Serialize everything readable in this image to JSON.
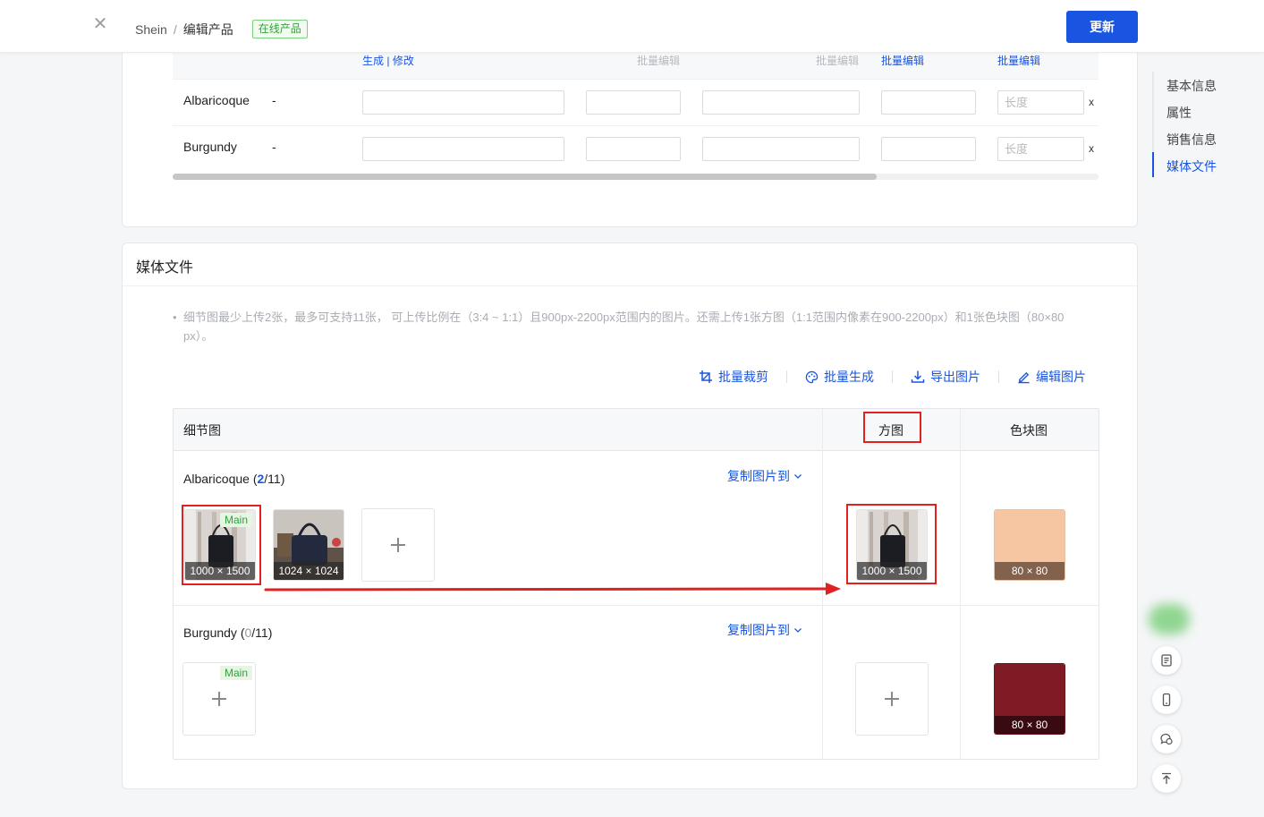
{
  "header": {
    "breadcrumb_root": "Shein",
    "breadcrumb_sep": "/",
    "breadcrumb_current": "编辑产品",
    "status_tag": "在线产品",
    "update_button": "更新"
  },
  "variants_table": {
    "header_links": {
      "generate": "生成",
      "divider": "|",
      "modify": "修改",
      "batch_edit_gray_1": "批量编辑",
      "batch_edit_gray_2": "批量编辑",
      "batch_edit_1": "批量编辑",
      "batch_edit_2": "批量编辑"
    },
    "rows": [
      {
        "name": "Albaricoque",
        "dash": "-",
        "length_placeholder": "长度",
        "x": "x"
      },
      {
        "name": "Burgundy",
        "dash": "-",
        "length_placeholder": "长度",
        "x": "x"
      }
    ]
  },
  "media": {
    "title": "媒体文件",
    "note_bullet": "•",
    "note": "细节图最少上传2张，最多可支持11张， 可上传比例在（3:4 ~ 1:1）且900px-2200px范围内的图片。还需上传1张方图（1:1范围内像素在900-2200px）和1张色块图（80×80 px）。",
    "actions": {
      "batch_crop": "批量裁剪",
      "batch_generate": "批量生成",
      "export_images": "导出图片",
      "edit_images": "编辑图片"
    },
    "columns": {
      "detail": "细节图",
      "square": "方图",
      "swatch": "色块图"
    },
    "copy_to": "复制图片到",
    "rows": [
      {
        "name": "Albaricoque",
        "count_open": "(",
        "count_current": "2",
        "count_max": "/11)",
        "main_badge": "Main",
        "detail_dims": [
          "1000 × 1500",
          "1024 × 1024"
        ],
        "square_dims": "1000 × 1500",
        "swatch_dims": "80 × 80",
        "swatch_color": "#f6c5a2"
      },
      {
        "name": "Burgundy",
        "count_open": "(",
        "count_current": "0",
        "count_max": "/11)",
        "main_badge": "Main",
        "swatch_dims": "80 × 80",
        "swatch_color": "#7e1b25"
      }
    ]
  },
  "anchor_nav": {
    "items": [
      "基本信息",
      "属性",
      "销售信息",
      "媒体文件"
    ],
    "active": "媒体文件"
  },
  "colors": {
    "primary": "#1955e0",
    "highlight": "#e0211f",
    "success": "#2ea43a"
  }
}
